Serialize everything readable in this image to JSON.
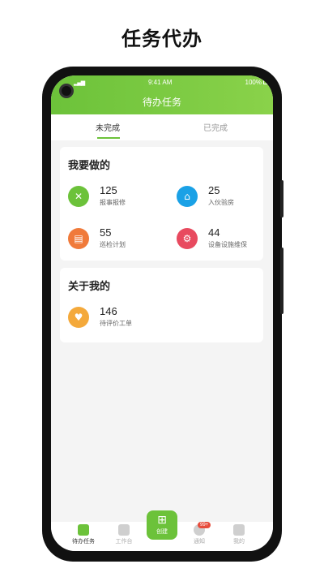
{
  "headline": "任务代办",
  "status_bar": {
    "time": "9:41 AM",
    "battery": "100%"
  },
  "app_title": "待办任务",
  "tabs": [
    {
      "label": "未完成",
      "active": true
    },
    {
      "label": "已完成",
      "active": false
    }
  ],
  "section_mine": {
    "title": "我要做的",
    "items": [
      {
        "count": "125",
        "label": "报事报修",
        "icon": "tools-icon",
        "color": "#6cc23a"
      },
      {
        "count": "25",
        "label": "入伙验房",
        "icon": "house-check-icon",
        "color": "#1aa1e6"
      },
      {
        "count": "55",
        "label": "巡检计划",
        "icon": "clipboard-icon",
        "color": "#f07a3a"
      },
      {
        "count": "44",
        "label": "设备设施维保",
        "icon": "device-maintenance-icon",
        "color": "#e84a5f"
      }
    ]
  },
  "section_about": {
    "title": "关于我的",
    "items": [
      {
        "count": "146",
        "label": "待评价工单",
        "icon": "heart-smile-icon",
        "color": "#f4a93b"
      }
    ]
  },
  "bottom_nav": {
    "items": [
      {
        "label": "待办任务",
        "active": true
      },
      {
        "label": "工作台",
        "active": false
      },
      {
        "label": "通知",
        "active": false
      },
      {
        "label": "我的",
        "active": false
      }
    ],
    "create": {
      "label": "创建"
    },
    "badge": "99+"
  },
  "colors": {
    "accent": "#6cc23a"
  }
}
